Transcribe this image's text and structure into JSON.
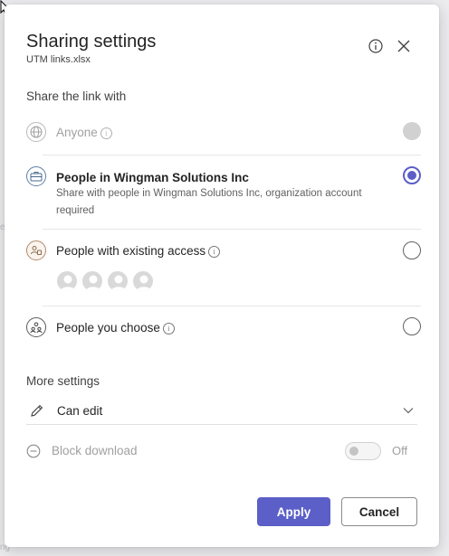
{
  "dialog": {
    "title": "Sharing settings",
    "subtitle": "UTM links.xlsx"
  },
  "share_section": {
    "label": "Share the link with",
    "options": [
      {
        "label": "Anyone",
        "icon": "globe-icon",
        "state": "disabled"
      },
      {
        "label": "People in Wingman Solutions Inc",
        "description": "Share with people in Wingman Solutions Inc, organization account required",
        "icon": "briefcase-icon",
        "state": "selected"
      },
      {
        "label": "People with existing access",
        "icon": "people-access-icon",
        "state": "unselected",
        "avatar_count": 4
      },
      {
        "label": "People you choose",
        "icon": "people-choose-icon",
        "state": "unselected"
      }
    ]
  },
  "more_settings": {
    "label": "More settings",
    "permission": {
      "selected": "Can edit",
      "icon": "pencil-icon"
    },
    "block_download": {
      "label": "Block download",
      "toggle_label": "Off",
      "icon": "minus-circle-icon",
      "state": "disabled"
    }
  },
  "buttons": {
    "apply": "Apply",
    "cancel": "Cancel"
  },
  "colors": {
    "accent": "#5b5fc7",
    "disabled": "#a0a0a0"
  }
}
